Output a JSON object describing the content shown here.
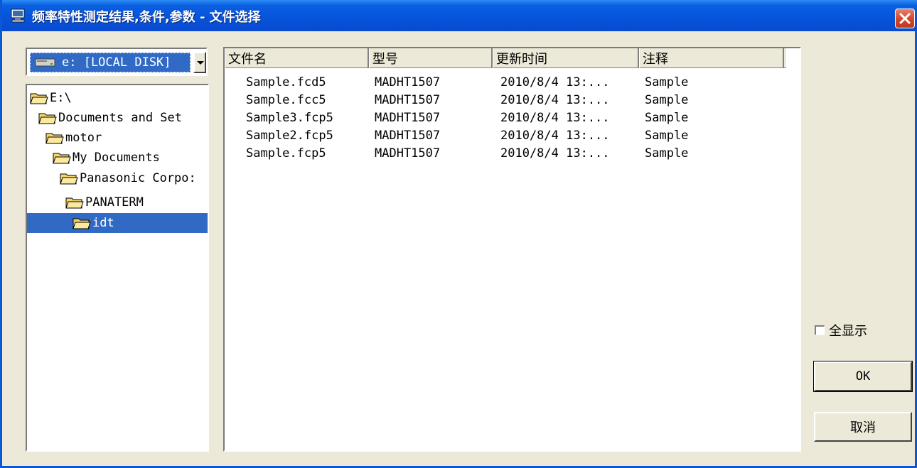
{
  "window": {
    "title": "频率特性测定结果,条件,参数 - 文件选择"
  },
  "drive": {
    "label": "e: [LOCAL DISK]"
  },
  "tree": {
    "items": [
      {
        "label": "E:\\"
      },
      {
        "label": "Documents and Set"
      },
      {
        "label": "motor"
      },
      {
        "label": "My Documents"
      },
      {
        "label": "Panasonic Corpo:"
      },
      {
        "label": "PANATERM"
      },
      {
        "label": "idt"
      }
    ],
    "selected": "idt"
  },
  "filelist": {
    "headers": [
      "文件名",
      "型号",
      "更新时间",
      "注释"
    ],
    "rows": [
      [
        "Sample.fcd5",
        "MADHT1507",
        "2010/8/4 13:...",
        "Sample"
      ],
      [
        "Sample.fcc5",
        "MADHT1507",
        "2010/8/4 13:...",
        "Sample"
      ],
      [
        "Sample3.fcp5",
        "MADHT1507",
        "2010/8/4 13:...",
        "Sample"
      ],
      [
        "Sample2.fcp5",
        "MADHT1507",
        "2010/8/4 13:...",
        "Sample"
      ],
      [
        "Sample.fcp5",
        "MADHT1507",
        "2010/8/4 13:...",
        "Sample"
      ]
    ]
  },
  "options": {
    "show_all_label": "全显示",
    "show_all_checked": false
  },
  "buttons": {
    "ok_label": "OK",
    "cancel_label": "取消"
  },
  "colors": {
    "titlebar": "#0553DA",
    "selection": "#316AC5",
    "face": "#ECE9D8"
  }
}
